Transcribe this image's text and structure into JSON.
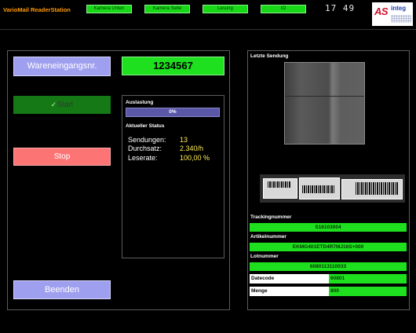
{
  "header": {
    "app_title": "VarioMail ReaderStation",
    "indicators": [
      "Kamera Unten",
      "Kamera Seite",
      "Lesung",
      "IO"
    ],
    "clock": "17 49",
    "logo": {
      "as": "AS",
      "brand": "integ"
    }
  },
  "left": {
    "wareneingang_label": "Wareneingangsnr.",
    "order_number": "1234567",
    "start_check": "✓",
    "start_label": "Start",
    "stop_label": "Stop",
    "beenden_label": "Beenden",
    "auslastung_label": "Auslastung",
    "load_percent_text": "0%",
    "load_fraction": 0.0,
    "status_title": "Aktueller Status",
    "stats": [
      {
        "name": "Sendungen:",
        "value": "13"
      },
      {
        "name": "Durchsatz:",
        "value": "2.340/h"
      },
      {
        "name": "Leserate:",
        "value": "100,00 %"
      }
    ]
  },
  "right": {
    "last_shipment_label": "Letzte Sendung",
    "tracking_label": "Trackingnummer",
    "tracking_value": "S16103004",
    "article_label": "Artikelnummer",
    "article_value": "EKMG401ETD4R7MJ16S+000",
    "lot_label": "Lotnummer",
    "lot_value": "6080113110033",
    "datecode_label": "Datecode",
    "datecode_value": "60801",
    "menge_label": "Menge",
    "menge_value": "800"
  },
  "colors": {
    "accent_orange": "#ff9900",
    "status_green": "#1ee01e",
    "button_lavender": "#9f9ff0",
    "stop_red": "#fd7474",
    "stat_yellow": "#ffee55"
  }
}
